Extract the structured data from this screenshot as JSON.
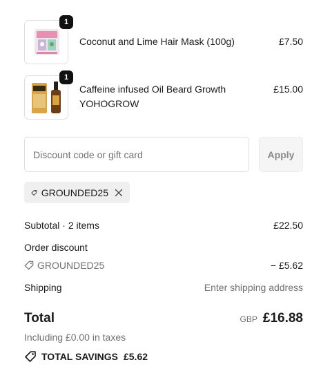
{
  "cart": {
    "items": [
      {
        "name": "Coconut and Lime Hair Mask (100g)",
        "quantity": "1",
        "price": "£7.50",
        "icon": "hair-mask-jar-thumbnail"
      },
      {
        "name_line1": "Caffeine infused Oil Beard Growth",
        "name_line2": "YOHOGROW",
        "quantity": "1",
        "price": "£15.00",
        "icon": "beard-oil-bottle-thumbnail"
      }
    ]
  },
  "discount": {
    "placeholder": "Discount code or gift card",
    "apply_label": "Apply",
    "applied_code": "GROUNDED25"
  },
  "summary": {
    "subtotal_label": "Subtotal · 2 items",
    "subtotal_value": "£22.50",
    "order_discount_label": "Order discount",
    "discount_code": "GROUNDED25",
    "discount_value": "− £5.62",
    "shipping_label": "Shipping",
    "shipping_value": "Enter shipping address",
    "total_label": "Total",
    "currency": "GBP",
    "total_value": "£16.88",
    "taxes_note": "Including £0.00 in taxes",
    "savings_label": "TOTAL SAVINGS",
    "savings_value": "£5.62"
  },
  "colors": {
    "text": "#1a1a1a",
    "muted": "#707070",
    "border": "#dedede",
    "badge": "#111111"
  }
}
